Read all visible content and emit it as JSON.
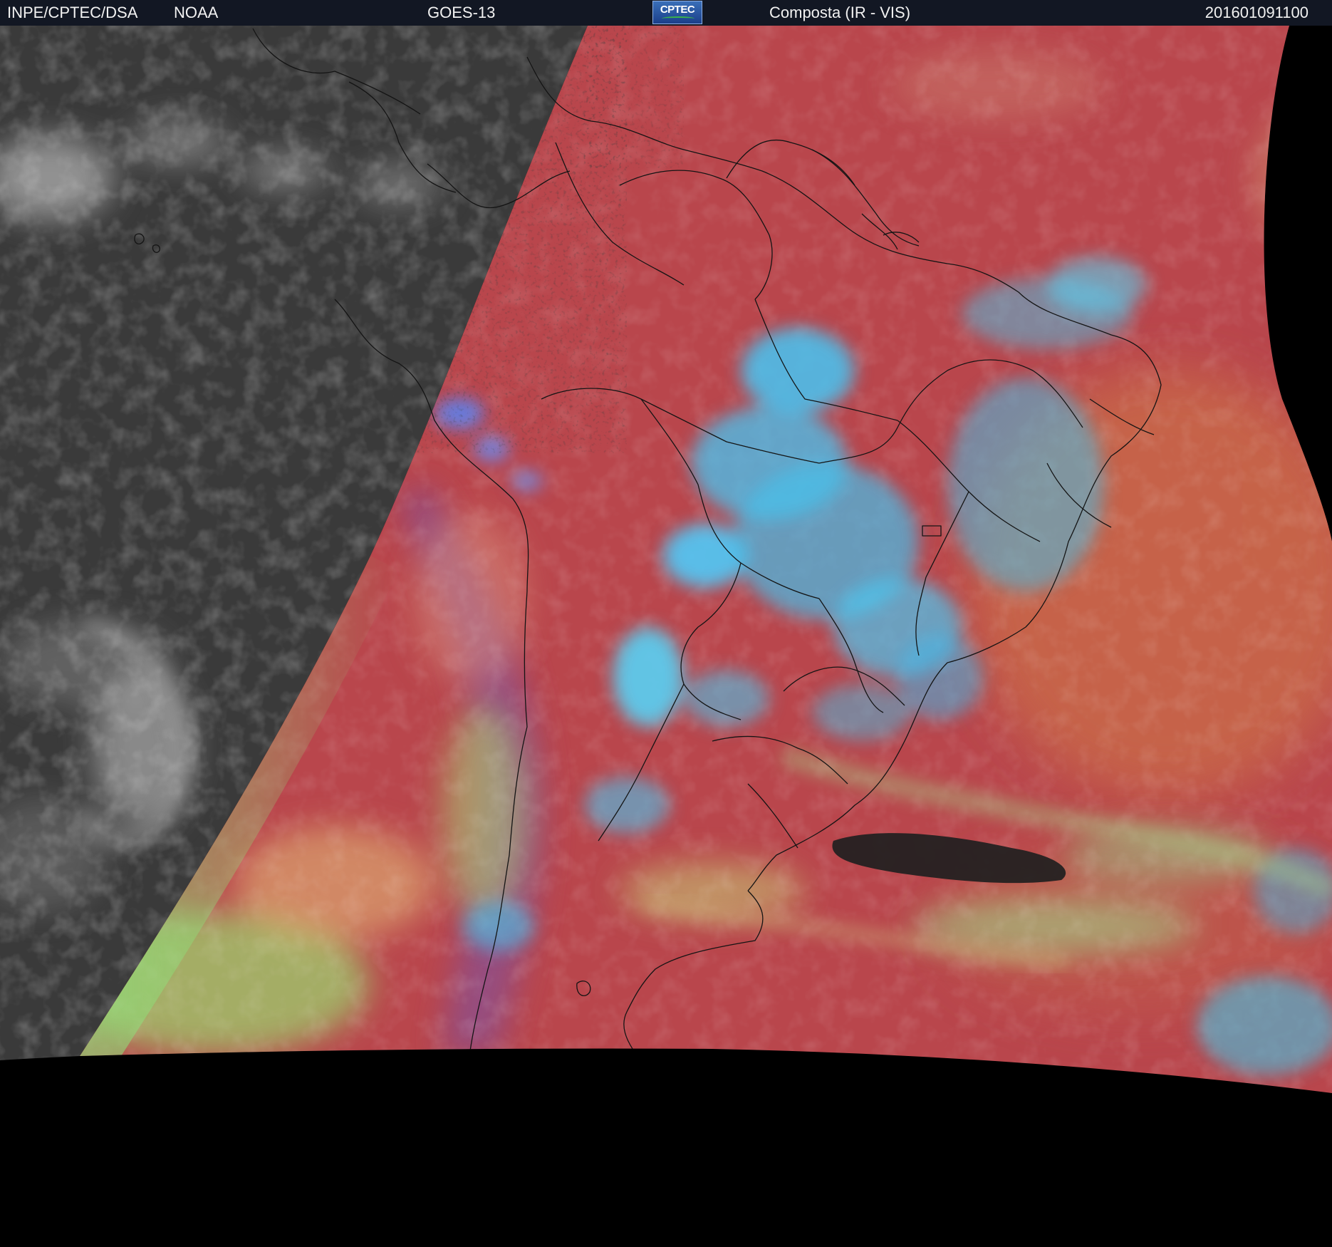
{
  "header": {
    "agency": "INPE/CPTEC/DSA",
    "partner": "NOAA",
    "satellite": "GOES-13",
    "logo_text": "CPTEC",
    "product": "Composta (IR - VIS)",
    "timestamp": "201601091100"
  },
  "colors": {
    "header_bg": "#121723",
    "ir_night": "#3a3a3a",
    "composite_land_warm": "#b9464c",
    "cloud_cyan": "#44c8f0",
    "cloud_blue": "#5a8cf0",
    "cloud_green": "#8ed27a",
    "ocean_orange": "#c8664a",
    "no_data": "#000000",
    "coastline": "#141414"
  },
  "icons": {
    "logo": "cptec-logo"
  }
}
